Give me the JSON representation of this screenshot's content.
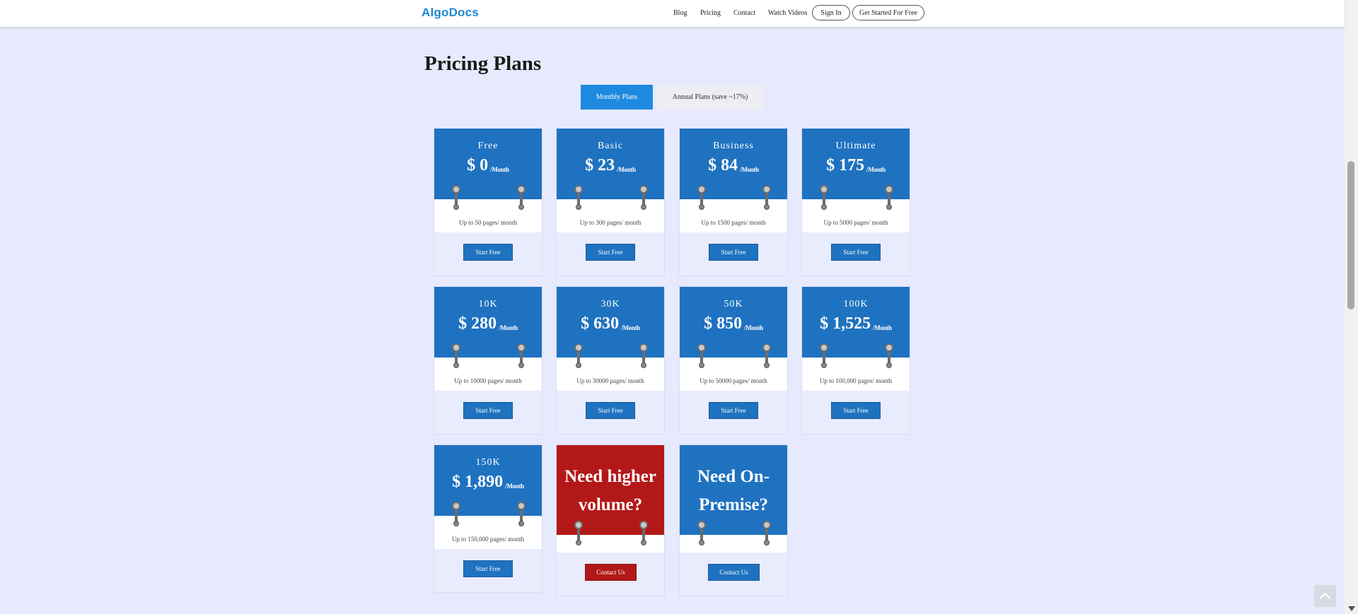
{
  "header": {
    "logo": "AlgoDocs",
    "nav": [
      "Blog",
      "Pricing",
      "Contact",
      "Watch Videos"
    ],
    "sign_in": "Sign In",
    "get_started": "Get Started For Free"
  },
  "page_title": "Pricing Plans",
  "tabs": {
    "monthly": "Monthly Plans",
    "annual": "Annual Plans (save ~17%)",
    "active": "monthly"
  },
  "plans": [
    {
      "name": "Free",
      "price": "$ 0",
      "per": "/Month",
      "quota": "Up to 50 pages/ month",
      "button": "Start Free"
    },
    {
      "name": "Basic",
      "price": "$ 23",
      "per": "/Month",
      "quota": "Up to 300 pages/ month",
      "button": "Start Free"
    },
    {
      "name": "Business",
      "price": "$ 84",
      "per": "/Month",
      "quota": "Up to 1500 pages/ month",
      "button": "Start Free"
    },
    {
      "name": "Ultimate",
      "price": "$ 175",
      "per": "/Month",
      "quota": "Up to 5000 pages/ month",
      "button": "Start Free"
    },
    {
      "name": "10K",
      "price": "$ 280",
      "per": "/Month",
      "quota": "Up to 10000 pages/ month",
      "button": "Start Free"
    },
    {
      "name": "30K",
      "price": "$ 630",
      "per": "/Month",
      "quota": "Up to 30000 pages/ month",
      "button": "Start Free"
    },
    {
      "name": "50K",
      "price": "$ 850",
      "per": "/Month",
      "quota": "Up to 50000 pages/ month",
      "button": "Start Free"
    },
    {
      "name": "100K",
      "price": "$ 1,525",
      "per": "/Month",
      "quota": "Up to 100,000 pages/ month",
      "button": "Start Free"
    },
    {
      "name": "150K",
      "price": "$ 1,890",
      "per": "/Month",
      "quota": "Up to 150,000 pages/ month",
      "button": "Start Free"
    }
  ],
  "special": [
    {
      "line1": "Need higher",
      "line2": "volume?",
      "button": "Contact Us",
      "color": "#b31818"
    },
    {
      "line1": "Need On-",
      "line2": "Premise?",
      "button": "Contact Us",
      "color": "#1f72c0"
    }
  ],
  "colors": {
    "accent": "#1f72c0",
    "tab_active": "#1d8ae0",
    "alert": "#b31818",
    "background": "#e6eafc"
  },
  "icons": {
    "back_to_top": "chevron-up-icon",
    "pin": "pin-icon"
  }
}
